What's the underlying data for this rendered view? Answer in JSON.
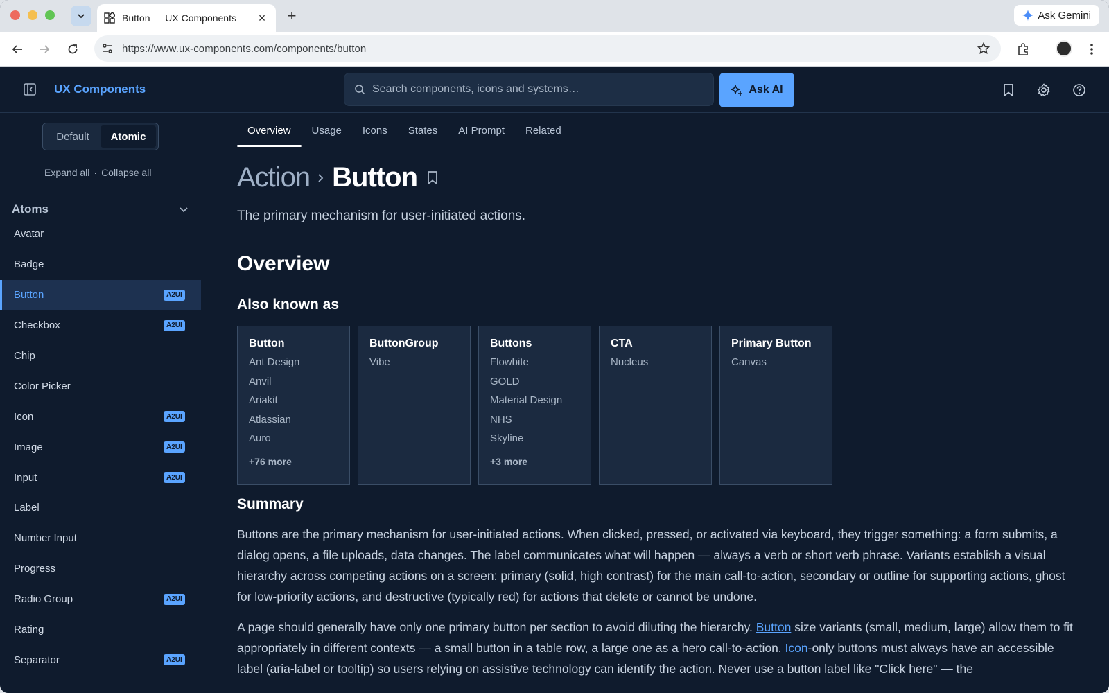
{
  "browser": {
    "tab_title": "Button — UX Components",
    "url": "https://www.ux-components.com/components/button",
    "ask_gemini": "Ask Gemini"
  },
  "header": {
    "brand": "UX Components",
    "search_placeholder": "Search components, icons and systems…",
    "ask_ai": "Ask AI"
  },
  "sidebar": {
    "toggle": {
      "default": "Default",
      "atomic": "Atomic"
    },
    "expand_all": "Expand all",
    "separator": "·",
    "collapse_all": "Collapse all",
    "section": "Atoms",
    "items": [
      {
        "label": "Avatar",
        "badge": ""
      },
      {
        "label": "Badge",
        "badge": ""
      },
      {
        "label": "Button",
        "badge": "A2UI"
      },
      {
        "label": "Checkbox",
        "badge": "A2UI"
      },
      {
        "label": "Chip",
        "badge": ""
      },
      {
        "label": "Color Picker",
        "badge": ""
      },
      {
        "label": "Icon",
        "badge": "A2UI"
      },
      {
        "label": "Image",
        "badge": "A2UI"
      },
      {
        "label": "Input",
        "badge": "A2UI"
      },
      {
        "label": "Label",
        "badge": ""
      },
      {
        "label": "Number Input",
        "badge": ""
      },
      {
        "label": "Progress",
        "badge": ""
      },
      {
        "label": "Radio Group",
        "badge": "A2UI"
      },
      {
        "label": "Rating",
        "badge": ""
      },
      {
        "label": "Separator",
        "badge": "A2UI"
      }
    ]
  },
  "main": {
    "tabs": [
      "Overview",
      "Usage",
      "Icons",
      "States",
      "AI Prompt",
      "Related"
    ],
    "breadcrumb_parent": "Action",
    "breadcrumb_current": "Button",
    "lede": "The primary mechanism for user-initiated actions.",
    "overview_heading": "Overview",
    "aka_heading": "Also known as",
    "aka_cards": [
      {
        "title": "Button",
        "items": [
          "Ant Design",
          "Anvil",
          "Ariakit",
          "Atlassian",
          "Auro"
        ],
        "more": "+76 more"
      },
      {
        "title": "ButtonGroup",
        "items": [
          "Vibe"
        ],
        "more": ""
      },
      {
        "title": "Buttons",
        "items": [
          "Flowbite",
          "GOLD",
          "Material Design",
          "NHS",
          "Skyline"
        ],
        "more": "+3 more"
      },
      {
        "title": "CTA",
        "items": [
          "Nucleus"
        ],
        "more": ""
      },
      {
        "title": "Primary Button",
        "items": [
          "Canvas"
        ],
        "more": ""
      }
    ],
    "summary_heading": "Summary",
    "summary_p1": "Buttons are the primary mechanism for user-initiated actions. When clicked, pressed, or activated via keyboard, they trigger something: a form submits, a dialog opens, a file uploads, data changes. The label communicates what will happen — always a verb or short verb phrase. Variants establish a visual hierarchy across competing actions on a screen: primary (solid, high contrast) for the main call-to-action, secondary or outline for supporting actions, ghost for low-priority actions, and destructive (typically red) for actions that delete or cannot be undone.",
    "summary_p2_a": "A page should generally have only one primary button per section to avoid diluting the hierarchy. ",
    "summary_p2_link1": "Button",
    "summary_p2_b": " size variants (small, medium, large) allow them to fit appropriately in different contexts — a small button in a table row, a large one as a hero call-to-action. ",
    "summary_p2_link2": "Icon",
    "summary_p2_c": "-only buttons must always have an accessible label (aria-label or tooltip) so users relying on assistive technology can identify the action. Never use a button label like \"Click here\" — the"
  },
  "colors": {
    "accent": "#5aa4ff",
    "background": "#0f1b2d",
    "card": "#1b2a40"
  }
}
